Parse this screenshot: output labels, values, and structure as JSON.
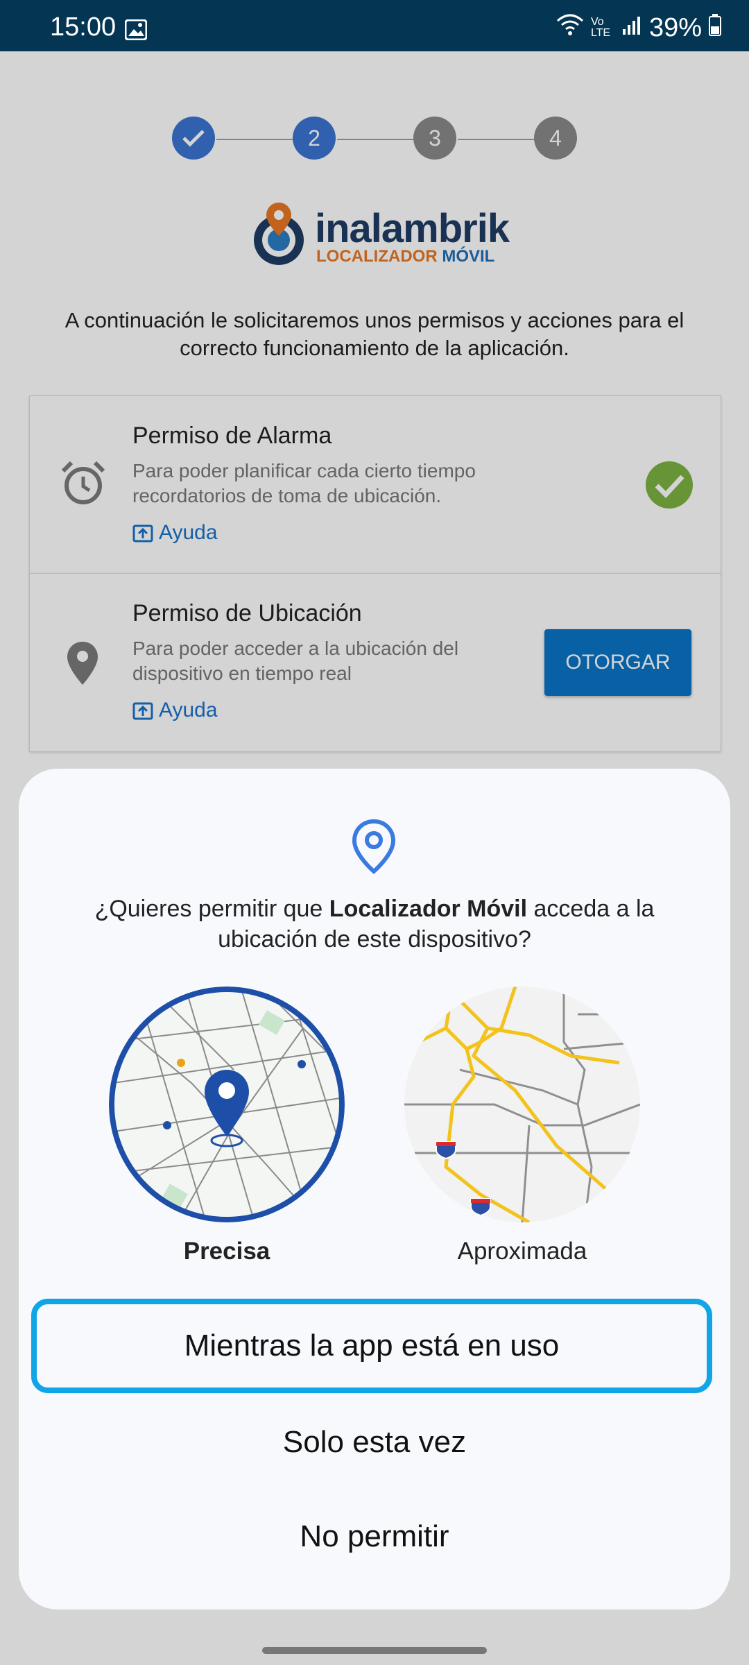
{
  "status_bar": {
    "time": "15:00",
    "battery": "39%",
    "network": "Vo LTE"
  },
  "stepper": {
    "steps": [
      "",
      "2",
      "3",
      "4"
    ],
    "active_color": "#3a74d2",
    "inactive_color": "#8a8a8a"
  },
  "logo": {
    "brand": "inalambrik",
    "sub_a": "LOCALIZADOR",
    "sub_b": "MÓVIL"
  },
  "intro_text": "A continuación le solicitaremos unos permisos y acciones para el correcto funcionamiento de la aplicación.",
  "permissions": [
    {
      "icon": "alarm-clock-icon",
      "title": "Permiso de Alarma",
      "description": "Para poder planificar cada cierto tiempo recordatorios de toma de ubicación.",
      "help": "Ayuda",
      "status": "granted"
    },
    {
      "icon": "location-pin-icon",
      "title": "Permiso de Ubicación",
      "description": "Para poder acceder a la ubicación del dispositivo en tiempo real",
      "help": "Ayuda",
      "button": "OTORGAR"
    }
  ],
  "dialog": {
    "question_pre": "¿Quieres permitir que ",
    "app_name": "Localizador Móvil",
    "question_post": " acceda a la ubicación de este dispositivo?",
    "precise_label": "Precisa",
    "approx_label": "Aproximada",
    "options": [
      "Mientras la app está en uso",
      "Solo esta vez",
      "No permitir"
    ],
    "accent_color": "#10a5e6"
  }
}
